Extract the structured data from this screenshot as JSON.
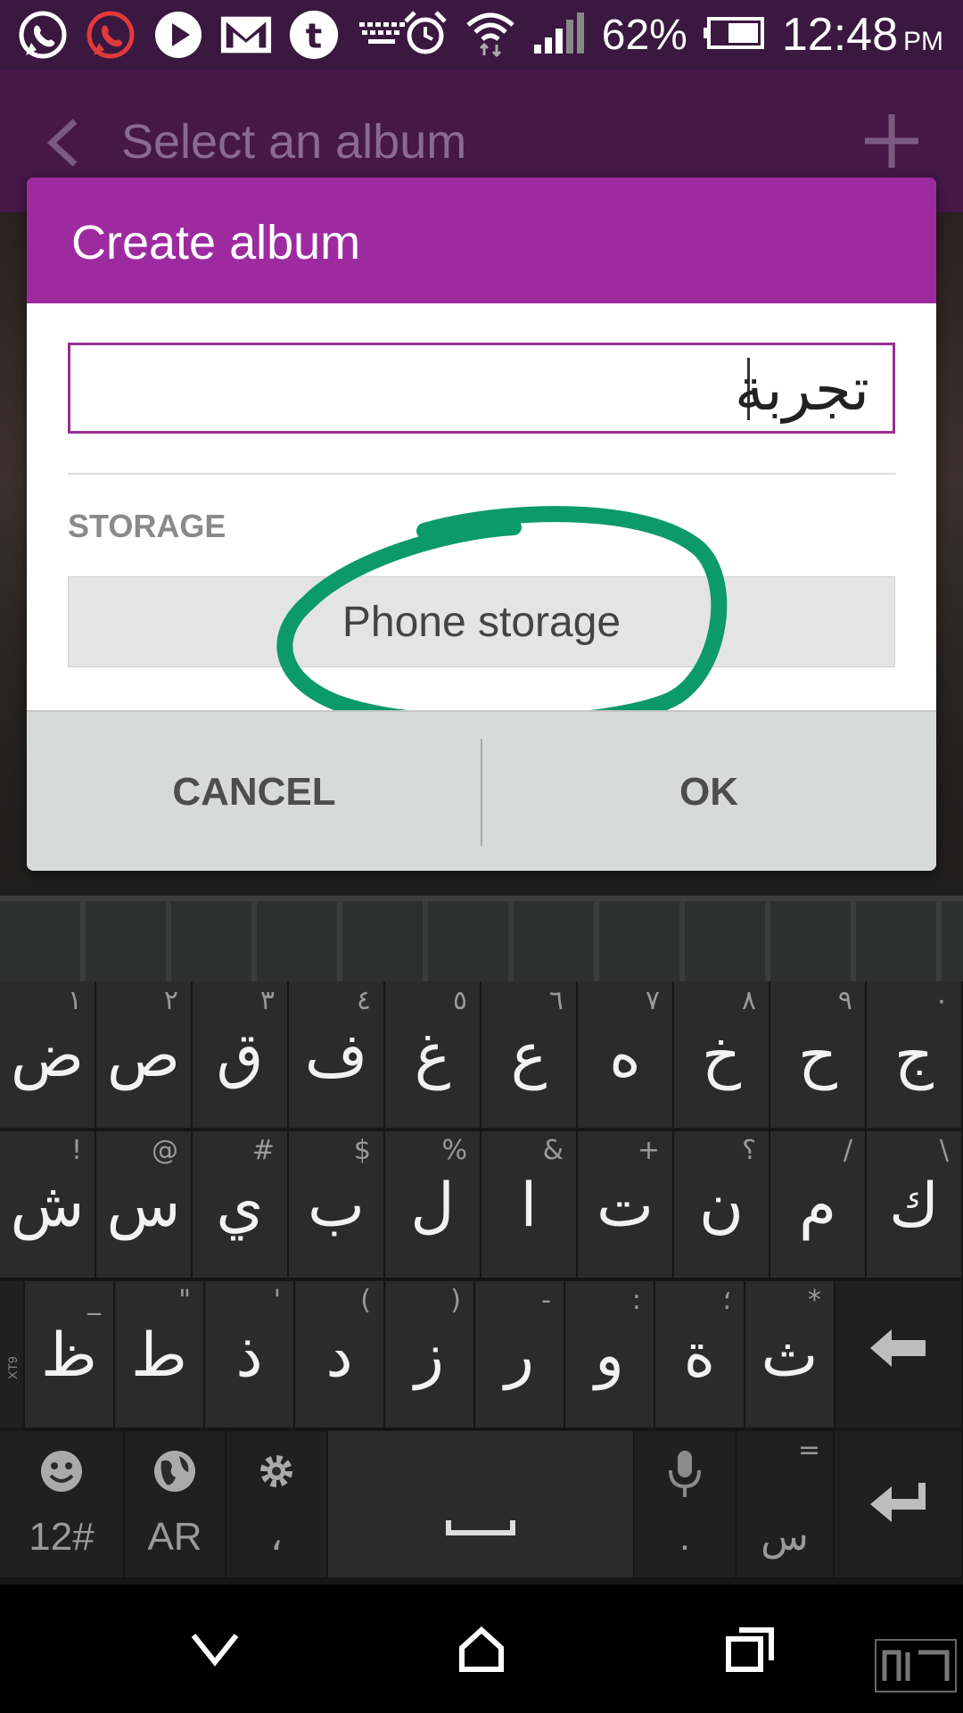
{
  "status_bar": {
    "battery": "62%",
    "time": "12:48",
    "ampm": "PM",
    "notification_icons": [
      "whatsapp-icon",
      "whatsapp-red-icon",
      "play-icon",
      "gmail-icon",
      "tumblr-icon",
      "keyboard-icon"
    ],
    "system_icons": [
      "alarm-icon",
      "wifi-icon",
      "signal-icon",
      "battery-icon"
    ]
  },
  "app_bar": {
    "title": "Select an album"
  },
  "dialog": {
    "title": "Create album",
    "album_name_value": "تجربة",
    "storage_label": "STORAGE",
    "storage_value": "Phone storage",
    "cancel_label": "CANCEL",
    "ok_label": "OK",
    "highlight_color": "#0d9a6a",
    "header_color": "#9e2aa0"
  },
  "keyboard": {
    "row1": [
      {
        "main": "ض",
        "hint": "١"
      },
      {
        "main": "ص",
        "hint": "٢"
      },
      {
        "main": "ق",
        "hint": "٣"
      },
      {
        "main": "ف",
        "hint": "٤"
      },
      {
        "main": "غ",
        "hint": "٥"
      },
      {
        "main": "ع",
        "hint": "٦"
      },
      {
        "main": "ه",
        "hint": "٧"
      },
      {
        "main": "خ",
        "hint": "٨"
      },
      {
        "main": "ح",
        "hint": "٩"
      },
      {
        "main": "ج",
        "hint": "٠"
      }
    ],
    "row2": [
      {
        "main": "ش",
        "hint": "!"
      },
      {
        "main": "س",
        "hint": "@"
      },
      {
        "main": "ي",
        "hint": "#"
      },
      {
        "main": "ب",
        "hint": "$"
      },
      {
        "main": "ل",
        "hint": "%"
      },
      {
        "main": "ا",
        "hint": "&"
      },
      {
        "main": "ت",
        "hint": "+"
      },
      {
        "main": "ن",
        "hint": "؟"
      },
      {
        "main": "م",
        "hint": "/"
      },
      {
        "main": "ك",
        "hint": "\\"
      }
    ],
    "row3": [
      {
        "main": "ظ",
        "hint": "_"
      },
      {
        "main": "ط",
        "hint": "\""
      },
      {
        "main": "ذ",
        "hint": "'"
      },
      {
        "main": "د",
        "hint": "("
      },
      {
        "main": "ز",
        "hint": ")"
      },
      {
        "main": "ر",
        "hint": "-"
      },
      {
        "main": "و",
        "hint": ":"
      },
      {
        "main": "ة",
        "hint": "؛"
      },
      {
        "main": "ث",
        "hint": "*"
      }
    ],
    "side_label": "XT9",
    "symbols_label": "12#",
    "language_label": "AR",
    "comma_label": "،",
    "period_label": ".",
    "sub_label": "س",
    "key_hint_eq": "="
  }
}
